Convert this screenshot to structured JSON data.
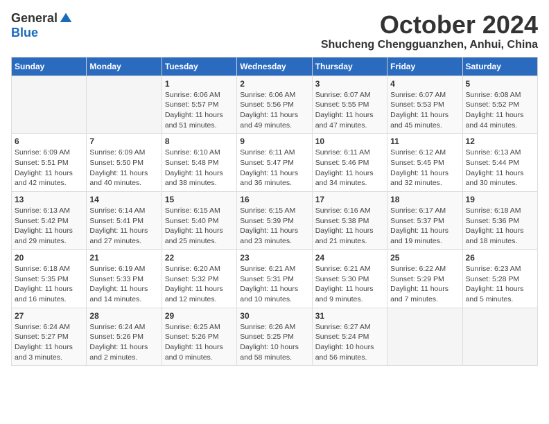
{
  "logo": {
    "general": "General",
    "blue": "Blue"
  },
  "title": {
    "month": "October 2024",
    "location": "Shucheng Chengguanzhen, Anhui, China"
  },
  "headers": [
    "Sunday",
    "Monday",
    "Tuesday",
    "Wednesday",
    "Thursday",
    "Friday",
    "Saturday"
  ],
  "weeks": [
    [
      {
        "day": "",
        "info": ""
      },
      {
        "day": "",
        "info": ""
      },
      {
        "day": "1",
        "info": "Sunrise: 6:06 AM\nSunset: 5:57 PM\nDaylight: 11 hours and 51 minutes."
      },
      {
        "day": "2",
        "info": "Sunrise: 6:06 AM\nSunset: 5:56 PM\nDaylight: 11 hours and 49 minutes."
      },
      {
        "day": "3",
        "info": "Sunrise: 6:07 AM\nSunset: 5:55 PM\nDaylight: 11 hours and 47 minutes."
      },
      {
        "day": "4",
        "info": "Sunrise: 6:07 AM\nSunset: 5:53 PM\nDaylight: 11 hours and 45 minutes."
      },
      {
        "day": "5",
        "info": "Sunrise: 6:08 AM\nSunset: 5:52 PM\nDaylight: 11 hours and 44 minutes."
      }
    ],
    [
      {
        "day": "6",
        "info": "Sunrise: 6:09 AM\nSunset: 5:51 PM\nDaylight: 11 hours and 42 minutes."
      },
      {
        "day": "7",
        "info": "Sunrise: 6:09 AM\nSunset: 5:50 PM\nDaylight: 11 hours and 40 minutes."
      },
      {
        "day": "8",
        "info": "Sunrise: 6:10 AM\nSunset: 5:48 PM\nDaylight: 11 hours and 38 minutes."
      },
      {
        "day": "9",
        "info": "Sunrise: 6:11 AM\nSunset: 5:47 PM\nDaylight: 11 hours and 36 minutes."
      },
      {
        "day": "10",
        "info": "Sunrise: 6:11 AM\nSunset: 5:46 PM\nDaylight: 11 hours and 34 minutes."
      },
      {
        "day": "11",
        "info": "Sunrise: 6:12 AM\nSunset: 5:45 PM\nDaylight: 11 hours and 32 minutes."
      },
      {
        "day": "12",
        "info": "Sunrise: 6:13 AM\nSunset: 5:44 PM\nDaylight: 11 hours and 30 minutes."
      }
    ],
    [
      {
        "day": "13",
        "info": "Sunrise: 6:13 AM\nSunset: 5:42 PM\nDaylight: 11 hours and 29 minutes."
      },
      {
        "day": "14",
        "info": "Sunrise: 6:14 AM\nSunset: 5:41 PM\nDaylight: 11 hours and 27 minutes."
      },
      {
        "day": "15",
        "info": "Sunrise: 6:15 AM\nSunset: 5:40 PM\nDaylight: 11 hours and 25 minutes."
      },
      {
        "day": "16",
        "info": "Sunrise: 6:15 AM\nSunset: 5:39 PM\nDaylight: 11 hours and 23 minutes."
      },
      {
        "day": "17",
        "info": "Sunrise: 6:16 AM\nSunset: 5:38 PM\nDaylight: 11 hours and 21 minutes."
      },
      {
        "day": "18",
        "info": "Sunrise: 6:17 AM\nSunset: 5:37 PM\nDaylight: 11 hours and 19 minutes."
      },
      {
        "day": "19",
        "info": "Sunrise: 6:18 AM\nSunset: 5:36 PM\nDaylight: 11 hours and 18 minutes."
      }
    ],
    [
      {
        "day": "20",
        "info": "Sunrise: 6:18 AM\nSunset: 5:35 PM\nDaylight: 11 hours and 16 minutes."
      },
      {
        "day": "21",
        "info": "Sunrise: 6:19 AM\nSunset: 5:33 PM\nDaylight: 11 hours and 14 minutes."
      },
      {
        "day": "22",
        "info": "Sunrise: 6:20 AM\nSunset: 5:32 PM\nDaylight: 11 hours and 12 minutes."
      },
      {
        "day": "23",
        "info": "Sunrise: 6:21 AM\nSunset: 5:31 PM\nDaylight: 11 hours and 10 minutes."
      },
      {
        "day": "24",
        "info": "Sunrise: 6:21 AM\nSunset: 5:30 PM\nDaylight: 11 hours and 9 minutes."
      },
      {
        "day": "25",
        "info": "Sunrise: 6:22 AM\nSunset: 5:29 PM\nDaylight: 11 hours and 7 minutes."
      },
      {
        "day": "26",
        "info": "Sunrise: 6:23 AM\nSunset: 5:28 PM\nDaylight: 11 hours and 5 minutes."
      }
    ],
    [
      {
        "day": "27",
        "info": "Sunrise: 6:24 AM\nSunset: 5:27 PM\nDaylight: 11 hours and 3 minutes."
      },
      {
        "day": "28",
        "info": "Sunrise: 6:24 AM\nSunset: 5:26 PM\nDaylight: 11 hours and 2 minutes."
      },
      {
        "day": "29",
        "info": "Sunrise: 6:25 AM\nSunset: 5:26 PM\nDaylight: 11 hours and 0 minutes."
      },
      {
        "day": "30",
        "info": "Sunrise: 6:26 AM\nSunset: 5:25 PM\nDaylight: 10 hours and 58 minutes."
      },
      {
        "day": "31",
        "info": "Sunrise: 6:27 AM\nSunset: 5:24 PM\nDaylight: 10 hours and 56 minutes."
      },
      {
        "day": "",
        "info": ""
      },
      {
        "day": "",
        "info": ""
      }
    ]
  ]
}
